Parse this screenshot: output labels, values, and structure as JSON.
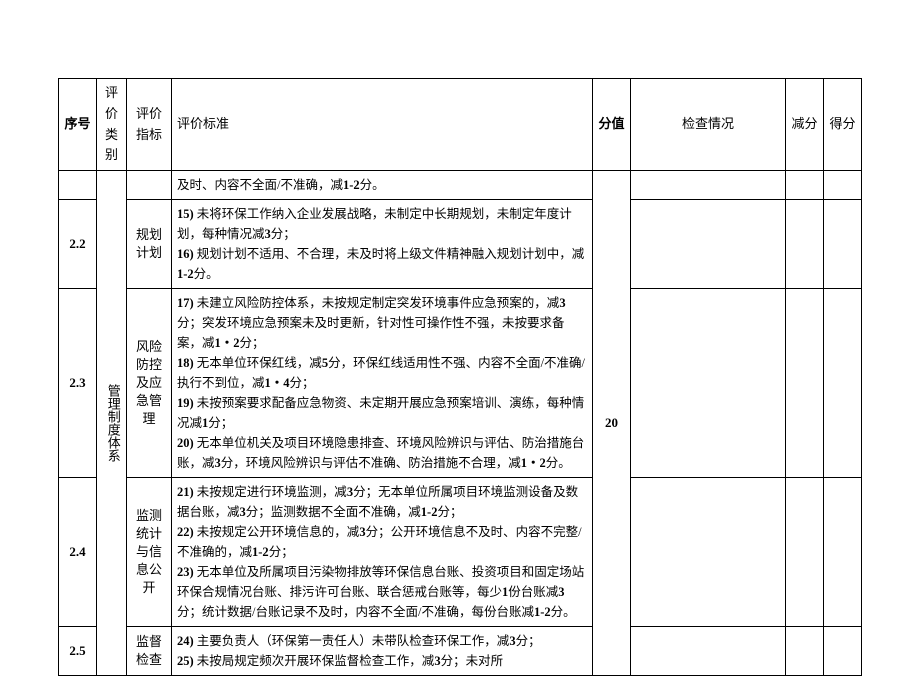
{
  "headers": {
    "seq": "序号",
    "cat": "评价类别",
    "ind": "评价指标",
    "std": "评价标准",
    "score": "分值",
    "check": "检查情况",
    "ded": "减分",
    "get": "得分"
  },
  "category": "管理制度体系",
  "score_value": "20",
  "rows": [
    {
      "seq": "",
      "ind": "",
      "std_html": "及时、内容不全面/不准确，减<b>1-2</b>分。"
    },
    {
      "seq": "2.2",
      "ind": "规划计划",
      "std_html": "<b>15)</b> 未将环保工作纳入企业发展战略，未制定中长期规划，未制定年度计划，每种情况减<b>3</b>分；<br><b>16)</b> 规划计划不适用、不合理，未及时将上级文件精神融入规划计划中，减<b>1-2</b>分。"
    },
    {
      "seq": "2.3",
      "ind": "风险防控及应急管理",
      "std_html": "<b>17)</b> 未建立风险防控体系，未按规定制定突发环境事件应急预案的，减<b>3</b>分；突发环境应急预案未及时更新，针对性可操作性不强，未按要求备案，减<b>1・2</b>分；<br><b>18)</b> 无本单位环保红线，减<b>5</b>分，环保红线适用性不强、内容不全面/不准确/执行不到位，减<b>1・4</b>分；<br><b>19)</b> 未按预案要求配备应急物资、未定期开展应急预案培训、演练，每种情况减<b>1</b>分；<br><b>20)</b> 无本单位机关及项目环境隐患排查、环境风险辨识与评估、防治措施台账，减<b>3</b>分，环境风险辨识与评估不准确、防治措施不合理，减<b>1・2</b>分。"
    },
    {
      "seq": "2.4",
      "ind": "监测统计与信息公开",
      "std_html": "<b>21)</b> 未按规定进行环境监测，减<b>3</b>分；无本单位所属项目环境监测设备及数据台账，减<b>3</b>分；监测数据不全面不准确，减<b>1-2</b>分；<br><b>22)</b> 未按规定公开环境信息的，减<b>3</b>分；公开环境信息不及时、内容不完整/不准确的，减<b>1-2</b>分；<br><b>23)</b> 无本单位及所属项目污染物排放等环保信息台账、投资项目和固定场站环保合规情况台账、排污许可台账、联合惩戒台账等，每少<b>1</b>份台账减<b>3</b>分；统计数据/台账记录不及时，内容不全面/不准确，每份台账减<b>1-2</b>分。"
    },
    {
      "seq": "2.5",
      "ind": "监督检查",
      "std_html": "<b>24)</b> 主要负责人（环保第一责任人）未带队检查环保工作，减<b>3</b>分；<br><b>25)</b> 未按局规定频次开展环保监督检查工作，减<b>3</b>分；未对所"
    }
  ]
}
